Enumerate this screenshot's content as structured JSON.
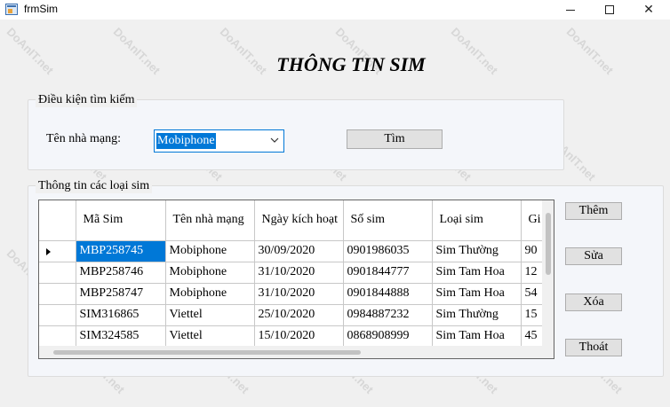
{
  "window": {
    "title": "frmSim",
    "minimize": "—",
    "maximize": "☐",
    "close": "✕"
  },
  "form_title": "THÔNG TIN SIM",
  "search_group": {
    "label": "Điều kiện tìm kiếm",
    "provider_label": "Tên nhà mạng:",
    "provider_value": "Mobiphone",
    "find_button": "Tìm"
  },
  "list_group": {
    "label": "Thông tin các loại sim"
  },
  "grid": {
    "columns": [
      "Mã Sim",
      "Tên nhà mạng",
      "Ngày kích hoạt",
      "Số sim",
      "Loại sim",
      "Gi"
    ],
    "rows": [
      [
        "MBP258745",
        "Mobiphone",
        "30/09/2020",
        "0901986035",
        "Sim Thường",
        "90"
      ],
      [
        "MBP258746",
        "Mobiphone",
        "31/10/2020",
        "0901844777",
        "Sim Tam Hoa",
        "12"
      ],
      [
        "MBP258747",
        "Mobiphone",
        "31/10/2020",
        "0901844888",
        "Sim Tam Hoa",
        "54"
      ],
      [
        "SIM316865",
        "Viettel",
        "25/10/2020",
        "0984887232",
        "Sim Thường",
        "15"
      ],
      [
        "SIM324585",
        "Viettel",
        "15/10/2020",
        "0868908999",
        "Sim Tam Hoa",
        "45"
      ]
    ]
  },
  "buttons": {
    "add": "Thêm",
    "edit": "Sửa",
    "delete": "Xóa",
    "exit": "Thoát"
  },
  "watermark": "DoAnIT.net",
  "colors": {
    "selection": "#0078d7",
    "window_bg": "#f0f0f0"
  }
}
